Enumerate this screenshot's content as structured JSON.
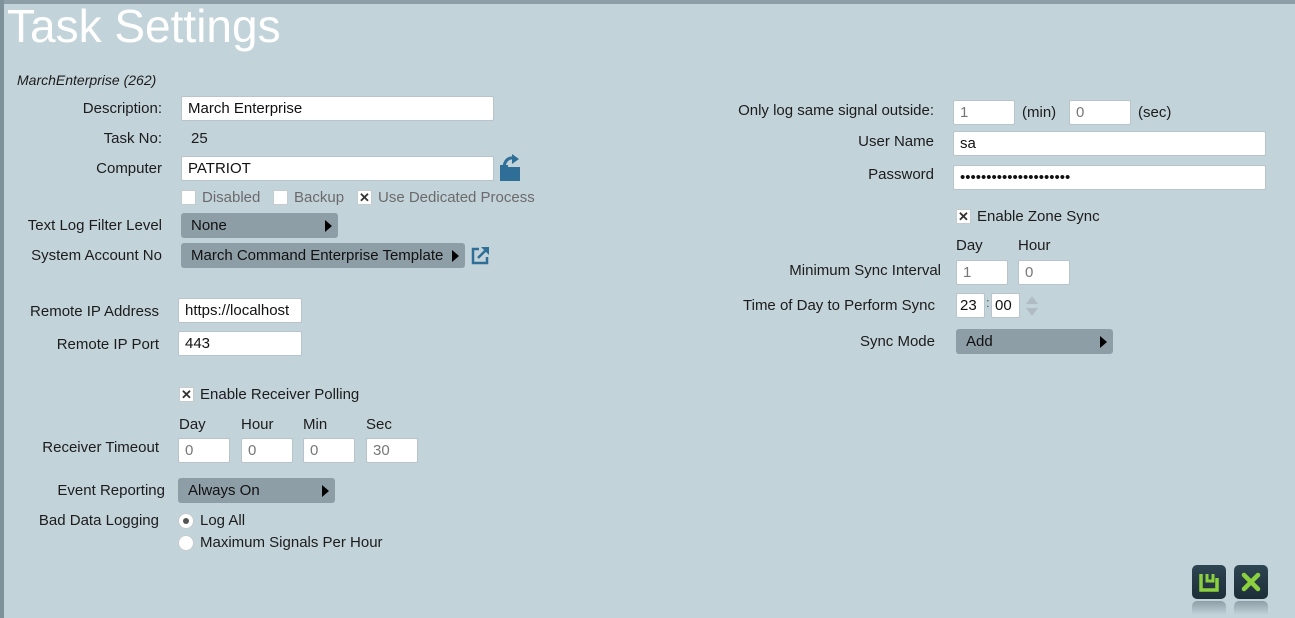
{
  "page": {
    "title": "Task Settings",
    "subtitle": "MarchEnterprise (262)"
  },
  "left": {
    "description": {
      "label": "Description:",
      "value": "March Enterprise"
    },
    "task_no": {
      "label": "Task No:",
      "value": "25"
    },
    "computer": {
      "label": "Computer",
      "value": "PATRIOT"
    },
    "checkboxes": [
      {
        "label": "Disabled",
        "checked": false
      },
      {
        "label": "Backup",
        "checked": false
      },
      {
        "label": "Use Dedicated Process",
        "checked": true
      }
    ],
    "text_log_filter": {
      "label": "Text Log Filter Level",
      "value": "None"
    },
    "system_account": {
      "label": "System Account No",
      "value": "March Command Enterprise Template"
    },
    "remote_ip_address": {
      "label": "Remote IP Address",
      "value": "https://localhost"
    },
    "remote_ip_port": {
      "label": "Remote IP Port",
      "value": "443"
    },
    "receiver_polling": {
      "label": "Enable Receiver Polling",
      "checked": true
    },
    "receiver_timeout": {
      "label": "Receiver Timeout",
      "columns": [
        "Day",
        "Hour",
        "Min",
        "Sec"
      ],
      "values": [
        "0",
        "0",
        "0",
        "30"
      ]
    },
    "event_reporting": {
      "label": "Event Reporting",
      "value": "Always On"
    },
    "bad_data_logging": {
      "label": "Bad Data Logging",
      "options": [
        "Log All",
        "Maximum Signals Per Hour"
      ],
      "selected": "Log All"
    }
  },
  "right": {
    "only_log": {
      "label": "Only log same signal outside:",
      "min_value": "1",
      "min_unit": "(min)",
      "sec_value": "0",
      "sec_unit": "(sec)"
    },
    "user_name": {
      "label": "User Name",
      "value": "sa"
    },
    "password": {
      "label": "Password",
      "value": "•••••••••••••••••••••"
    },
    "zone_sync": {
      "label": "Enable Zone Sync",
      "checked": true
    },
    "min_sync_interval": {
      "label": "Minimum Sync Interval",
      "columns": [
        "Day",
        "Hour"
      ],
      "values": [
        "1",
        "0"
      ]
    },
    "time_of_day": {
      "label": "Time of Day to Perform Sync",
      "hour": "23",
      "separator": ":",
      "minute": "00"
    },
    "sync_mode": {
      "label": "Sync Mode",
      "value": "Add"
    }
  },
  "actions": {
    "save": "save-icon",
    "cancel": "close-icon"
  },
  "colors": {
    "background": "#c3d3da",
    "select_bg": "#8e9ea6",
    "action_icon": "#8bd13f",
    "action_bg": "#22343f",
    "icon_blue": "#2f6e96"
  }
}
